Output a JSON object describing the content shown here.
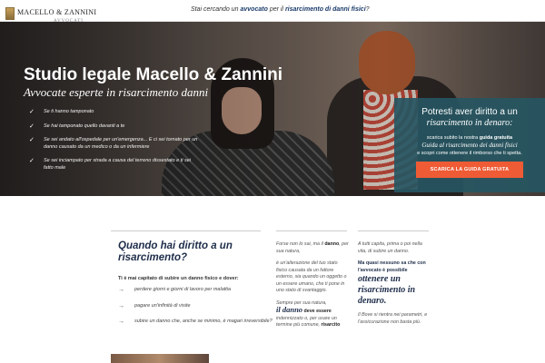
{
  "header": {
    "logo_text": "MACELLO & ZANNINI",
    "logo_sub": "AVVOCATI",
    "tagline_pre": "Stai cercando un",
    "tagline_b1": "avvocato",
    "tagline_mid": "per il",
    "tagline_b2": "risarcimento di danni fisici",
    "tagline_end": "?"
  },
  "hero": {
    "title": "Studio legale Macello & Zannini",
    "subtitle": "Avvocate esperte in risarcimento danni",
    "items": [
      "Se ti hanno tamponato",
      "Se hai tamponato quello davanti a te",
      "Se sei andato all'ospedale per un'emergenza... E ci sei tornato per un danno causato da un medico o da un infermiere",
      "Se sei inciampato per strada a causa del terreno dissestato e ti sei fatto male"
    ],
    "check_glyph": "✓"
  },
  "guide": {
    "title1": "Potresti aver diritto a un",
    "title2": "risarcimento in denaro:",
    "text_pre": "scarica subito la nostra",
    "text_bold": "guida gratuita",
    "text_italic": "Guida al risarcimento dei danni fisici",
    "text_post": "e scopri come ottenere il rimborso che ti spetta.",
    "button": "SCARICA LA GUIDA GRATUITA",
    "accent": "#ef5b35",
    "panel_color": "#265662"
  },
  "section": {
    "title": "Quando hai diritto a un risarcimento?",
    "lead": "Ti è mai capitato di subire un danno fisico e dover:",
    "items": [
      "perdere giorni e giorni di lavoro per malattia",
      "pagare un'infinità di visite",
      "subire un danno che, anche se minimo, è magari irreversibile?"
    ],
    "arrow_glyph": "→"
  },
  "col_mid": {
    "p1_pre": "Forse non lo sai, ma il",
    "p1_b": "danno",
    "p1_post": ", per sua natura,",
    "p2": "è un'alterazione del tuo stato fisico causata da un fattore esterno, sia quando un oggetto o un essere umano, che ti pone in uno stato di svantaggio.",
    "p3_pre": "Sempre per sua natura,",
    "p3_big": "il danno",
    "p3_b": "deve essere",
    "p3_mid": "indennizzato o, per usare un termine più comune,",
    "p3_end": "risarcito"
  },
  "col_right": {
    "p1": "A tutti capita, prima o poi nella vita, di subire un danno.",
    "p2_b": "Ma quasi nessuno sa che con l'avvocato è possibile",
    "p2_big": "ottenere un risarcimento in denaro.",
    "p3": "Il Bove si rientra nei parametri, e l'assicurazione non basta più."
  }
}
